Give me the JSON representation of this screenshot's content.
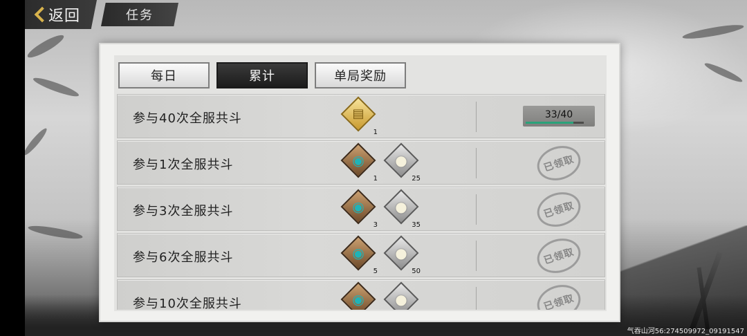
{
  "nav": {
    "back_label": "返回",
    "title": "任务"
  },
  "tabs": [
    {
      "label": "每日",
      "active": false
    },
    {
      "label": "累计",
      "active": true
    },
    {
      "label": "单局奖励",
      "active": false
    }
  ],
  "tasks": [
    {
      "label": "参与40次全服共斗",
      "rewards": [
        {
          "icon": "scroll-book-icon",
          "qty": "1"
        }
      ],
      "status": "progress",
      "progress_text": "33/40",
      "progress_fraction": 0.825
    },
    {
      "label": "参与1次全服共斗",
      "rewards": [
        {
          "icon": "token-icon",
          "qty": "1"
        },
        {
          "icon": "silver-ingot-icon",
          "qty": "25"
        }
      ],
      "status": "claimed",
      "stamp": "已领取"
    },
    {
      "label": "参与3次全服共斗",
      "rewards": [
        {
          "icon": "token-icon",
          "qty": "3"
        },
        {
          "icon": "silver-ingot-icon",
          "qty": "35"
        }
      ],
      "status": "claimed",
      "stamp": "已领取"
    },
    {
      "label": "参与6次全服共斗",
      "rewards": [
        {
          "icon": "token-icon",
          "qty": "5"
        },
        {
          "icon": "silver-ingot-icon",
          "qty": "50"
        }
      ],
      "status": "claimed",
      "stamp": "已领取"
    },
    {
      "label": "参与10次全服共斗",
      "rewards": [
        {
          "icon": "token-icon",
          "qty": ""
        },
        {
          "icon": "silver-ingot-icon",
          "qty": ""
        }
      ],
      "status": "claimed",
      "stamp": "已领取"
    }
  ],
  "watermark": "气吞山河56:274509972_09191547",
  "colors": {
    "progress_fill": "#2aa37a",
    "active_tab": "#1c1c1c",
    "back_chevron": "#d8b34c"
  }
}
